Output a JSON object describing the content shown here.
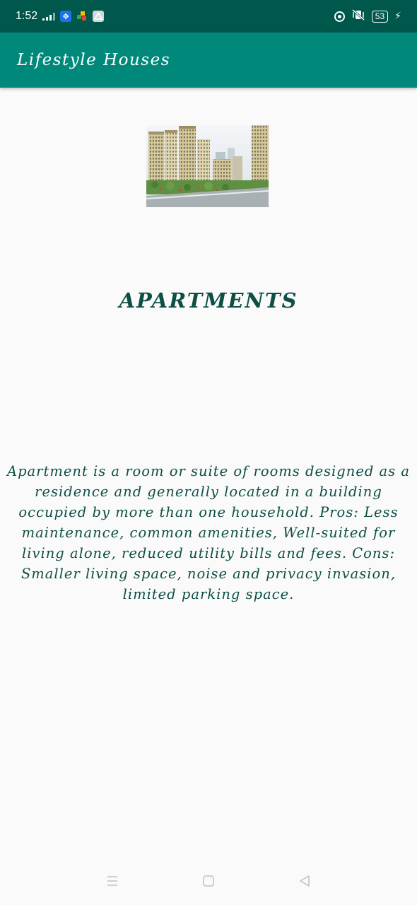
{
  "status_bar": {
    "time": "1:52",
    "battery_level": "53",
    "icons": [
      "signal-icon",
      "app-icon-blue",
      "app-icon-multicolor",
      "app-icon-drive",
      "focus-icon",
      "vibrate-icon",
      "battery-icon",
      "charging-icon"
    ]
  },
  "app_bar": {
    "title": "Lifestyle Houses"
  },
  "content": {
    "image_name": "apartments-building-image",
    "heading": "APARTMENTS",
    "description": "Apartment is a room or suite of rooms designed as a residence and generally located in a building occupied by more than one household.  Pros: Less maintenance, common amenities, Well-suited for living alone, reduced utility bills and fees.  Cons: Smaller living space, noise and privacy invasion, limited parking space."
  },
  "navigation": {
    "buttons": [
      "recents-button",
      "home-button",
      "back-button"
    ]
  },
  "colors": {
    "status_bar": "#00574b",
    "app_bar": "#00897b",
    "text_primary": "#0d4f45",
    "background": "#fafafa"
  }
}
